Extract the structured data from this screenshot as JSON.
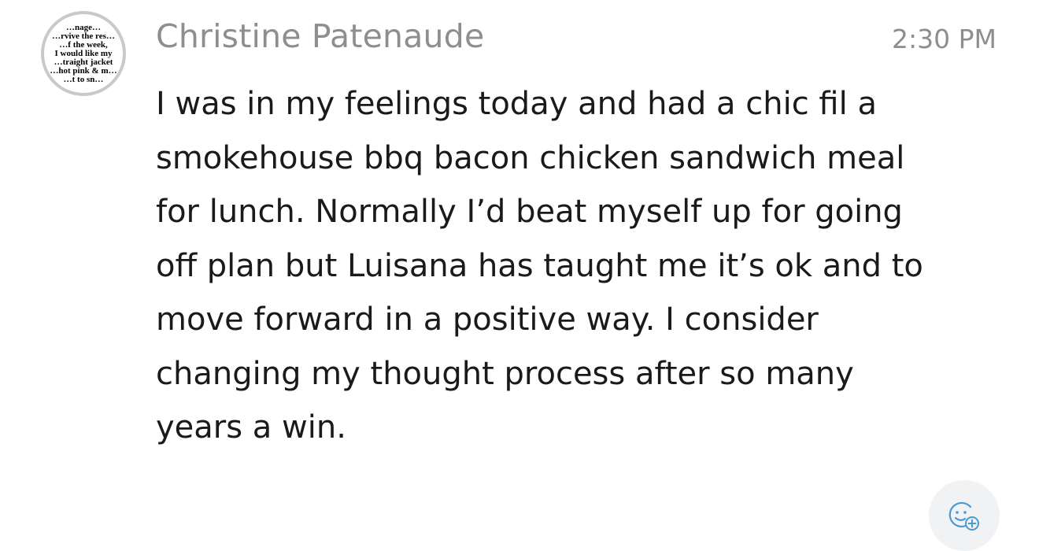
{
  "post": {
    "sender_name": "Christine Patenaude",
    "timestamp": "2:30 PM",
    "avatar": {
      "lines": [
        "…nage…",
        "…rvive the res…",
        "…f the week,",
        "I would like my",
        "…traight jacket",
        "…hot pink & m…",
        "…t to sn…"
      ]
    },
    "message_lines": [
      "I was in my feelings today and had a chic fil a",
      "smokehouse bbq bacon chicken sandwich meal",
      "for lunch.  Normally I’d beat myself up for going",
      "off plan but Luisana has taught me it’s ok and to",
      "move forward in a positive way.  I consider",
      "changing my thought process after so many",
      "years a win."
    ]
  },
  "reaction": {
    "icon": "add-reaction-icon",
    "accent_color": "#4a9ad4",
    "button_bg": "#f1f2f4"
  }
}
